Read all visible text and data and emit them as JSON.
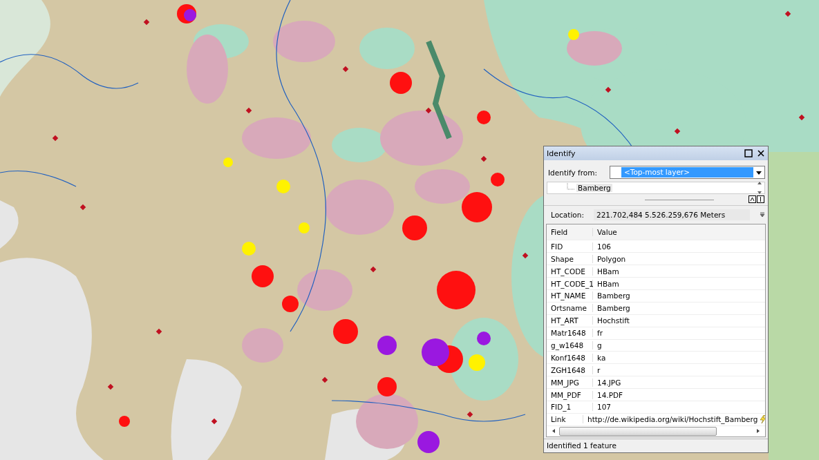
{
  "identify": {
    "title": "Identify",
    "identify_from_label": "Identify from:",
    "identify_from_value": "<Top-most layer>",
    "tree": [
      {
        "label": "Bamberg",
        "selected": true
      }
    ],
    "location_label": "Location:",
    "location_value": "221.702,484  5.526.259,676 Meters",
    "columns": [
      "Field",
      "Value"
    ],
    "rows": [
      {
        "field": "FID",
        "value": "106"
      },
      {
        "field": "Shape",
        "value": "Polygon"
      },
      {
        "field": "HT_CODE",
        "value": "HBam"
      },
      {
        "field": "HT_CODE_1",
        "value": "HBam"
      },
      {
        "field": "HT_NAME",
        "value": "Bamberg"
      },
      {
        "field": "Ortsname",
        "value": "Bamberg"
      },
      {
        "field": "HT_ART",
        "value": "Hochstift"
      },
      {
        "field": "Matr1648",
        "value": "fr"
      },
      {
        "field": "g_w1648",
        "value": "g"
      },
      {
        "field": "Konf1648",
        "value": "ka"
      },
      {
        "field": "ZGH1648",
        "value": "r"
      },
      {
        "field": "MM_JPG",
        "value": "14.JPG"
      },
      {
        "field": "MM_PDF",
        "value": "14.PDF"
      },
      {
        "field": "FID_1",
        "value": "107"
      },
      {
        "field": "Link",
        "value": "http://de.wikipedia.org/wiki/Hochstift_Bamberg",
        "kind": "link"
      }
    ],
    "status": "Identified 1 feature"
  }
}
